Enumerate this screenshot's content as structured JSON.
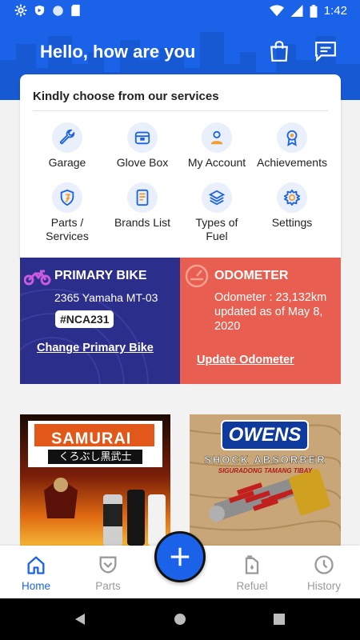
{
  "status_bar": {
    "time": "1:42"
  },
  "header": {
    "greeting": "Hello, how are you"
  },
  "services": {
    "title": "Kindly choose from our services",
    "items": [
      {
        "label": "Garage",
        "icon": "wrench-icon"
      },
      {
        "label": "Glove Box",
        "icon": "box-icon"
      },
      {
        "label": "My Account",
        "icon": "user-icon"
      },
      {
        "label": "Achievements",
        "icon": "award-icon"
      },
      {
        "label": "Parts / Services",
        "icon": "shield-icon"
      },
      {
        "label": "Brands List",
        "icon": "card-icon"
      },
      {
        "label": "Types of Fuel",
        "icon": "layers-icon"
      },
      {
        "label": "Settings",
        "icon": "gear-icon"
      }
    ]
  },
  "primary_bike": {
    "title": "PRIMARY BIKE",
    "model": "2365 Yamaha  MT-03",
    "plate": "#NCA231",
    "link": "Change Primary Bike"
  },
  "odometer": {
    "title": "ODOMETER",
    "text": "Odometer : 23,132km updated as of May 8, 2020",
    "link": "Update Odometer"
  },
  "promos": [
    {
      "brand": "SAMURAI",
      "mark": "®",
      "subtitle": "くろぶし黒武士"
    },
    {
      "brand": "OWENS",
      "subtitle": "SHOCK ABSORBER",
      "tagline": "SIGURADONG TAMANG TIBAY"
    }
  ],
  "bottom_nav": [
    {
      "label": "Home",
      "active": true
    },
    {
      "label": "Parts",
      "active": false
    },
    {
      "label": "Refuel",
      "active": false
    },
    {
      "label": "History",
      "active": false
    }
  ],
  "colors": {
    "primary": "#1a63e8",
    "bike_panel": "#2c2e8c",
    "odometer_panel": "#e85e50"
  }
}
